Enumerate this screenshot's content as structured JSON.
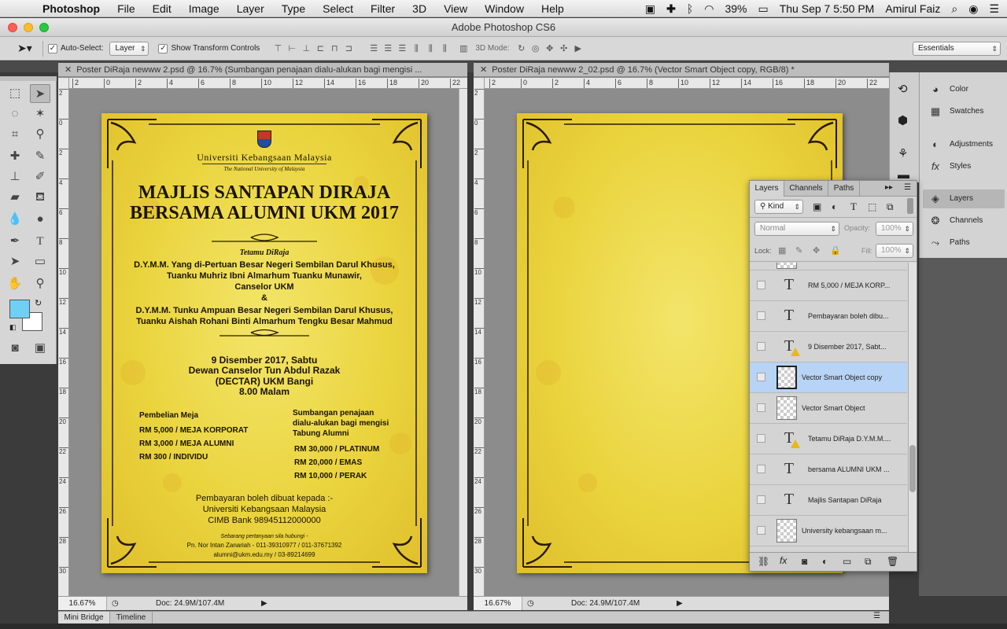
{
  "menubar": {
    "app": "Photoshop",
    "items": [
      "File",
      "Edit",
      "Image",
      "Layer",
      "Type",
      "Select",
      "Filter",
      "3D",
      "View",
      "Window",
      "Help"
    ],
    "battery": "39%",
    "clock": "Thu Sep 7  5:50 PM",
    "user": "Amirul Faiz"
  },
  "window": {
    "title": "Adobe Photoshop CS6"
  },
  "options": {
    "auto_select_label": "Auto-Select:",
    "auto_select_value": "Layer",
    "transform_label": "Show Transform Controls",
    "mode3d_label": "3D Mode:",
    "workspace": "Essentials"
  },
  "doc1": {
    "tab": "Poster DiRaja newww 2.psd @ 16.7% (Sumbangan penajaan  dialu-alukan bagi mengisi ...",
    "ruler_h": [
      "2",
      "0",
      "2",
      "4",
      "6",
      "8",
      "10",
      "12",
      "14",
      "16",
      "18",
      "20",
      "22"
    ],
    "ruler_v": [
      "2",
      "0",
      "2",
      "4",
      "6",
      "8",
      "10",
      "12",
      "14",
      "16",
      "18",
      "20",
      "22",
      "24",
      "26",
      "28",
      "30"
    ],
    "zoom": "16.67%",
    "docsize": "Doc: 24.9M/107.4M"
  },
  "doc2": {
    "tab": "Poster DiRaja newww 2_02.psd @ 16.7% (Vector Smart Object copy, RGB/8) *",
    "ruler_h": [
      "2",
      "0",
      "2",
      "4",
      "6",
      "8",
      "10",
      "12",
      "14",
      "16",
      "18",
      "20",
      "22"
    ],
    "ruler_v": [
      "2",
      "0",
      "2",
      "4",
      "6",
      "8",
      "10",
      "12",
      "14",
      "16",
      "18",
      "20",
      "22",
      "24",
      "26",
      "28",
      "30"
    ],
    "zoom": "16.67%",
    "docsize": "Doc: 24.9M/107.4M"
  },
  "poster": {
    "uni_name": "Universiti Kebangsaan Malaysia",
    "uni_sub": "The National University of Malaysia",
    "title1": "MAJLIS SANTAPAN DIRAJA",
    "title2": "BERSAMA ALUMNI UKM 2017",
    "guest_label": "Tetamu DiRaja",
    "guest1a": "D.Y.M.M. Yang di-Pertuan Besar Negeri Sembilan Darul Khusus,",
    "guest1b": "Tuanku Muhriz Ibni Almarhum Tuanku Munawir,",
    "guest1c": "Canselor UKM",
    "amp": "&",
    "guest2a": "D.Y.M.M. Tunku Ampuan Besar Negeri Sembilan Darul Khusus,",
    "guest2b": "Tuanku Aishah Rohani Binti Almarhum Tengku Besar Mahmud",
    "date": "9 Disember 2017, Sabtu",
    "venue1": "Dewan Canselor Tun Abdul Razak",
    "venue2": "(DECTAR) UKM Bangi",
    "time": "8.00 Malam",
    "left_head": "Pembelian Meja",
    "left_items": [
      "RM 5,000 / MEJA KORPORAT",
      "RM 3,000 / MEJA ALUMNI",
      "RM 300 / INDIVIDU"
    ],
    "right_head1": "Sumbangan penajaan",
    "right_head2": "dialu-alukan bagi mengisi",
    "right_head3": "Tabung Alumni",
    "right_items": [
      "RM 30,000 / PLATINUM",
      "RM 20,000 / EMAS",
      "RM 10,000 / PERAK"
    ],
    "pay1": "Pembayaran boleh dibuat kepada :-",
    "pay2": "Universiti Kebangsaan Malaysia",
    "pay3": "CIMB Bank 98945112000000",
    "contact_label": "Sebarang pertanyaan sila hubungi  -",
    "contact1": "Pn. Nor Intan Zanariah - 011-39310977 / 011-37671392",
    "contact2": "alumni@ukm.edu.my / 03-89214699"
  },
  "right_panels": {
    "top": [
      "Color",
      "Swatches"
    ],
    "mid": [
      "Adjustments",
      "Styles"
    ],
    "bottom": [
      "Layers",
      "Channels",
      "Paths"
    ]
  },
  "layers_panel": {
    "tabs": [
      "Layers",
      "Channels",
      "Paths"
    ],
    "filter": "Kind",
    "blend": "Normal",
    "opacity_label": "Opacity:",
    "opacity": "100%",
    "lock_label": "Lock:",
    "fill_label": "Fill:",
    "fill": "100%",
    "rows": [
      {
        "name": "RM 5,000 / MEJA KORP...",
        "kind": "text",
        "warn": false
      },
      {
        "name": "Pembayaran boleh dibu...",
        "kind": "text",
        "warn": false
      },
      {
        "name": "9 Disember 2017, Sabt...",
        "kind": "text",
        "warn": true
      },
      {
        "name": "Vector Smart Object copy",
        "kind": "smart",
        "warn": false,
        "selected": true
      },
      {
        "name": "Vector Smart Object",
        "kind": "smart",
        "warn": false
      },
      {
        "name": "Tetamu DiRaja D.Y.M.M....",
        "kind": "text",
        "warn": true
      },
      {
        "name": "bersama ALUMNI UKM ...",
        "kind": "text",
        "warn": false
      },
      {
        "name": "Majlis Santapan DiRaja",
        "kind": "text",
        "warn": false
      },
      {
        "name": "University kebangsaan m...",
        "kind": "smart",
        "warn": false
      }
    ]
  },
  "bottom_tabs": [
    "Mini Bridge",
    "Timeline"
  ],
  "colors": {
    "accent_selection": "#b7d3f5",
    "foreground": "#6fd0f5",
    "poster_gold": "#e9d23c"
  }
}
